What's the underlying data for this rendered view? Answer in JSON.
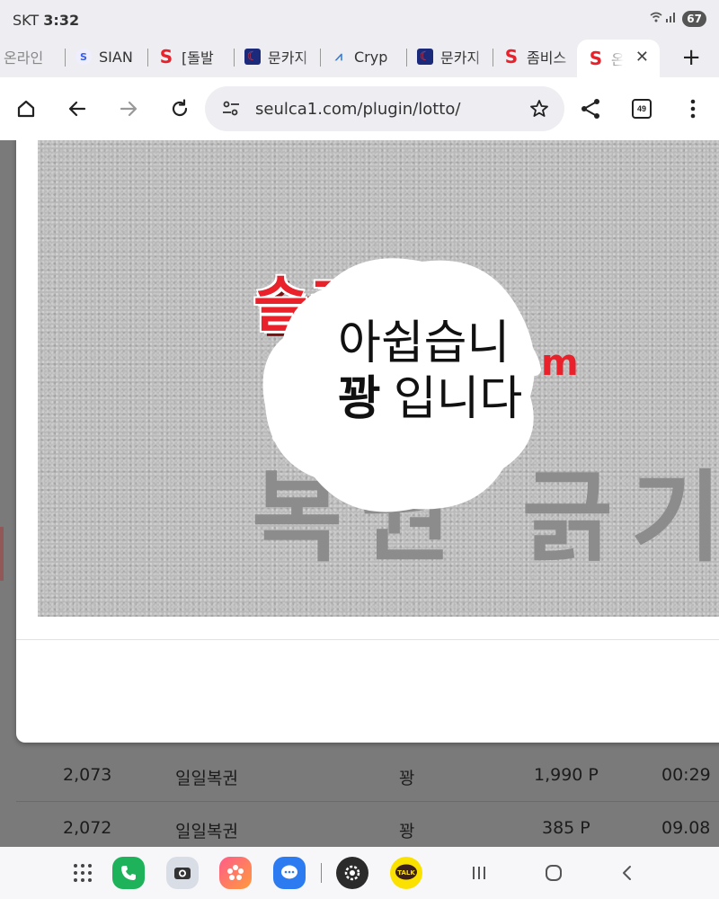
{
  "status": {
    "carrier": "SKT",
    "time": "3:32",
    "battery": "67"
  },
  "tabs": [
    {
      "label": "온라인",
      "favicon": "none-icon"
    },
    {
      "label": "SIAN",
      "favicon": "sian-icon"
    },
    {
      "label": "[돌발",
      "favicon": "s-logo-icon"
    },
    {
      "label": "문카지",
      "favicon": "moon-icon"
    },
    {
      "label": "Cryp",
      "favicon": "crypto-icon"
    },
    {
      "label": "문카지",
      "favicon": "moon-icon"
    },
    {
      "label": "좀비스",
      "favicon": "s-logo-icon"
    },
    {
      "label": "온",
      "favicon": "s-logo-icon",
      "active": true
    }
  ],
  "toolbar": {
    "url": "seulca1.com/plugin/lotto/",
    "tab_count": "49"
  },
  "banner": {
    "brand_text": "슬카지노",
    "brand_suffix": "m",
    "background_text": "복권 긁기",
    "scratch_line1": "아쉽습니",
    "scratch_line2_bold": "꽝",
    "scratch_line2": "입니다"
  },
  "table": {
    "rows": [
      {
        "no": "2,073",
        "type": "일일복권",
        "result": "꽝",
        "point": "1,990 P",
        "time": "00:29"
      },
      {
        "no": "2,072",
        "type": "일일복권",
        "result": "꽝",
        "point": "385 P",
        "time": "09.08"
      }
    ]
  },
  "colors": {
    "brand_red": "#e8212a",
    "chrome_bg": "#ededf2"
  }
}
